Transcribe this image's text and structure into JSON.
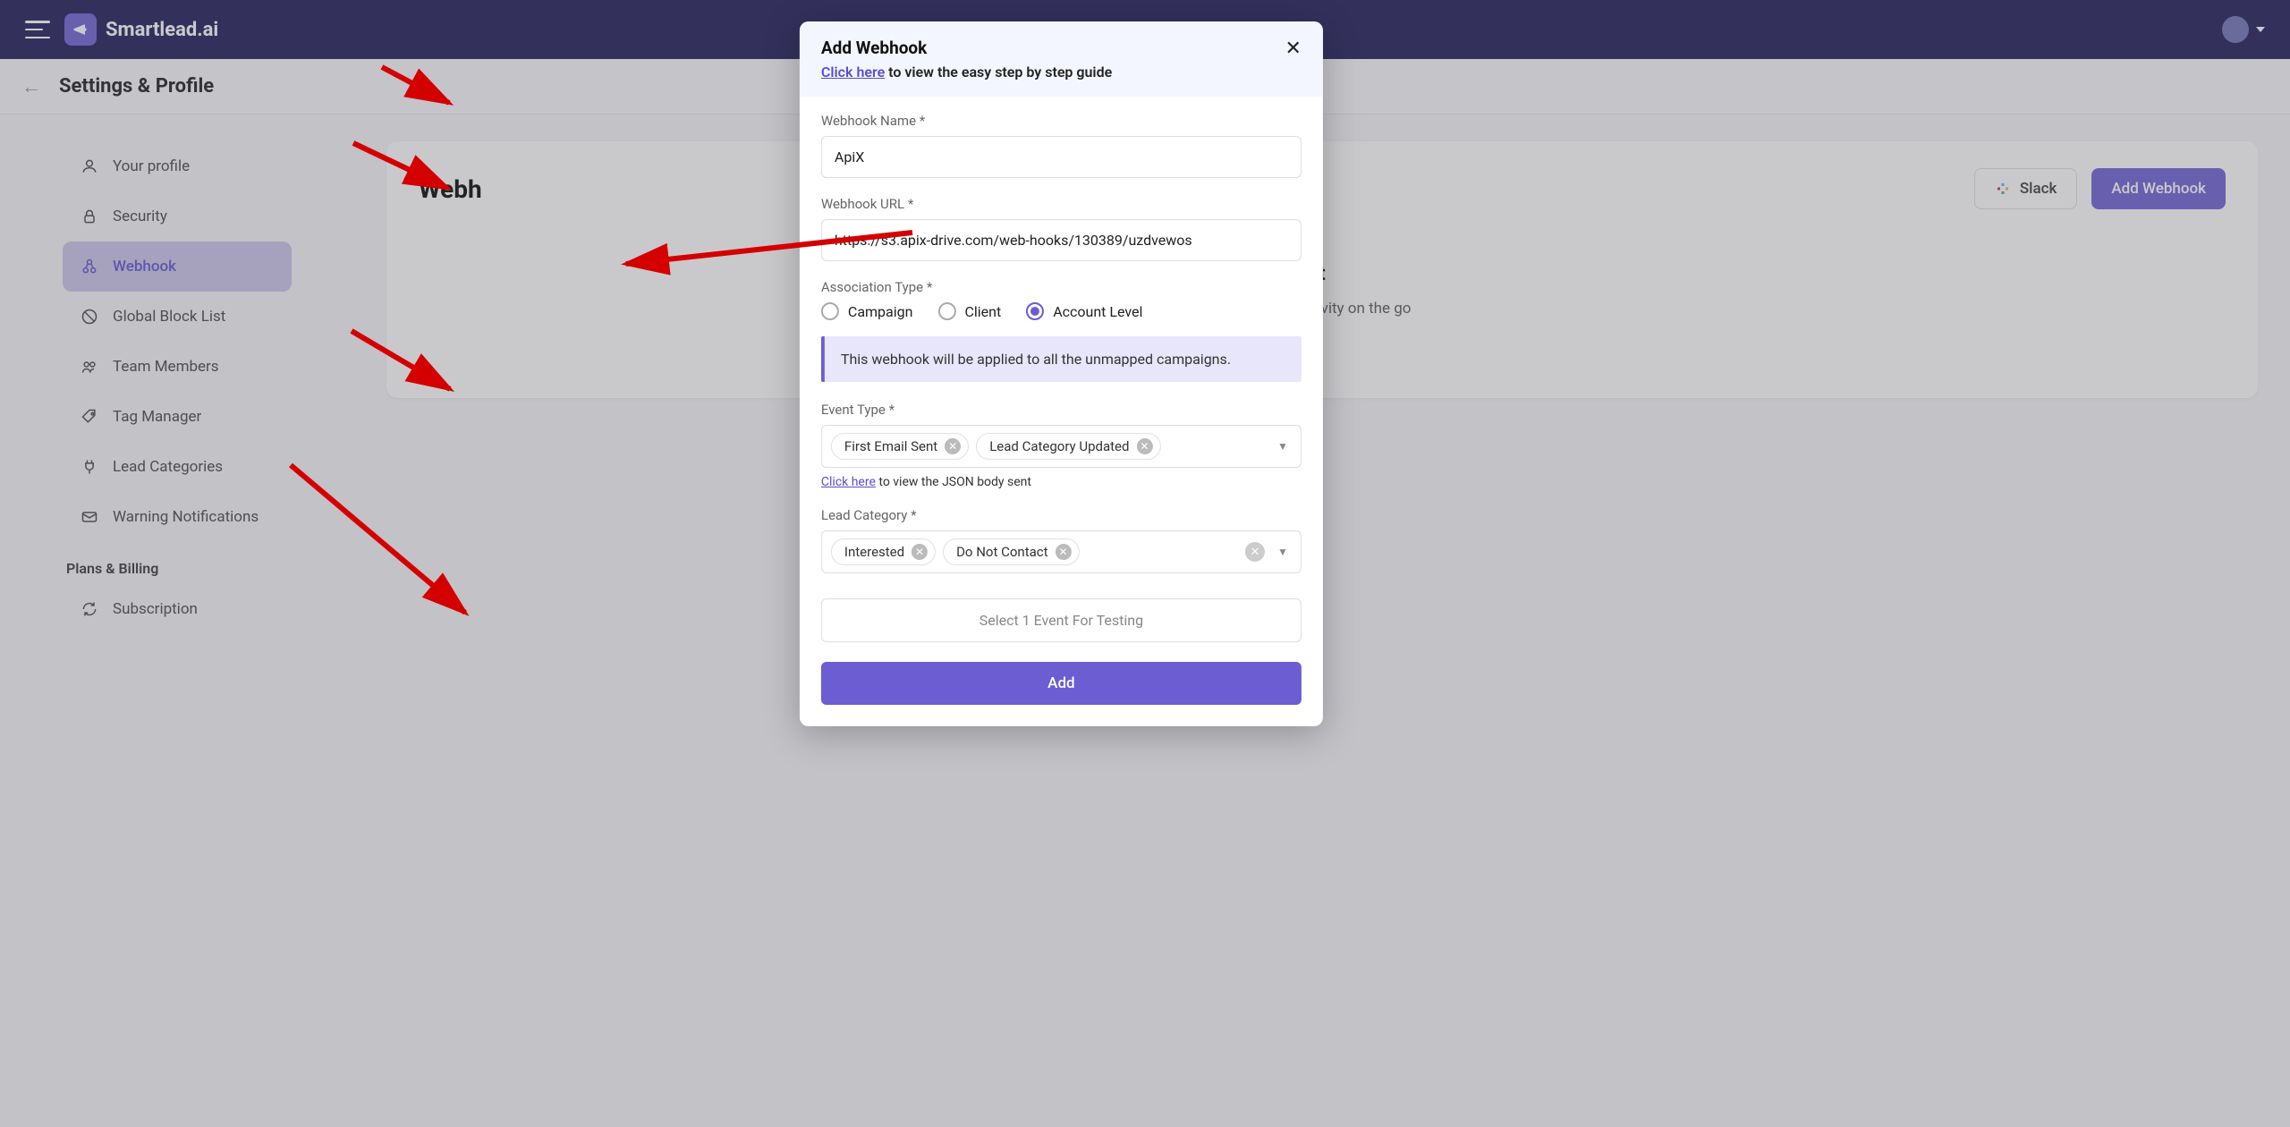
{
  "brand": "Smartlead.ai",
  "page_title": "Settings & Profile",
  "sidebar": {
    "items": [
      {
        "label": "Your profile"
      },
      {
        "label": "Security"
      },
      {
        "label": "Webhook"
      },
      {
        "label": "Global Block List"
      },
      {
        "label": "Team Members"
      },
      {
        "label": "Tag Manager"
      },
      {
        "label": "Lead Categories"
      },
      {
        "label": "Warning Notifications"
      }
    ],
    "section_label": "Plans & Billing",
    "billing_items": [
      {
        "label": "Subscription"
      }
    ]
  },
  "main_card": {
    "title_full": "Webhook",
    "title_visible": "Webh",
    "slack_label": "Slack",
    "add_label": "Add Webhook",
    "empty_suffix": "t",
    "empty_body_suffix": "ampaign activity on the go"
  },
  "modal": {
    "title": "Add Webhook",
    "guide_link": "Click here",
    "guide_rest": " to view the easy step by step guide",
    "fields": {
      "name_label": "Webhook Name *",
      "name_value": "ApiX",
      "url_label": "Webhook URL *",
      "url_value": "https://s3.apix-drive.com/web-hooks/130389/uzdvewos",
      "assoc_label": "Association Type *",
      "assoc_options": [
        "Campaign",
        "Client",
        "Account Level"
      ],
      "assoc_selected": "Account Level",
      "assoc_banner": "This webhook will be applied to all the unmapped campaigns.",
      "event_label": "Event Type *",
      "event_chips": [
        "First Email Sent",
        "Lead Category Updated"
      ],
      "json_link": "Click here",
      "json_rest": " to view the JSON body sent",
      "leadcat_label": "Lead Category *",
      "leadcat_chips": [
        "Interested",
        "Do Not Contact"
      ],
      "test_label": "Select 1 Event For Testing",
      "add_label": "Add"
    }
  }
}
